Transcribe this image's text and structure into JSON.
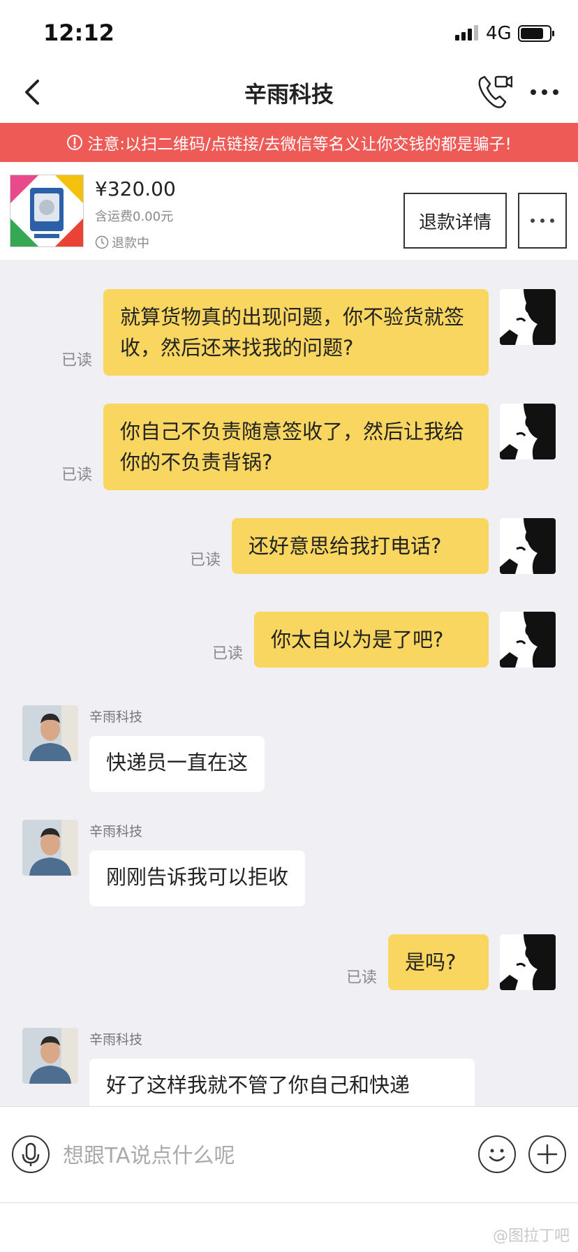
{
  "status_bar": {
    "time": "12:12",
    "network": "4G"
  },
  "nav": {
    "title": "辛雨科技"
  },
  "warning": {
    "text": "注意:以扫二维码/点链接/去微信等名义让你交钱的都是骗子!"
  },
  "order": {
    "price": "¥320.00",
    "shipping": "含运费0.00元",
    "status": "退款中",
    "refund_detail_label": "退款详情"
  },
  "messages": [
    {
      "side": "out",
      "text": "就算货物真的出现问题，你不验货就签收，然后还来找我的问题?",
      "read": "已读"
    },
    {
      "side": "out",
      "text": "你自己不负责随意签收了，然后让我给你的不负责背锅?",
      "read": "已读"
    },
    {
      "side": "out",
      "text": "还好意思给我打电话?",
      "read": "已读"
    },
    {
      "side": "out",
      "text": "你太自以为是了吧?",
      "read": "已读"
    },
    {
      "side": "in",
      "sender": "辛雨科技",
      "text": "快递员一直在这"
    },
    {
      "side": "in",
      "sender": "辛雨科技",
      "text": "刚刚告诉我可以拒收"
    },
    {
      "side": "out",
      "text": "是吗?",
      "read": "已读"
    },
    {
      "side": "in",
      "sender": "辛雨科技",
      "text": "好了这样我就不管了你自己和快递"
    }
  ],
  "input": {
    "placeholder": "想跟TA说点什么呢"
  },
  "watermark": "@图拉丁吧",
  "colors": {
    "bubble_out": "#f8d660",
    "warning_bg": "#ee5a55",
    "background": "#efeff4"
  }
}
